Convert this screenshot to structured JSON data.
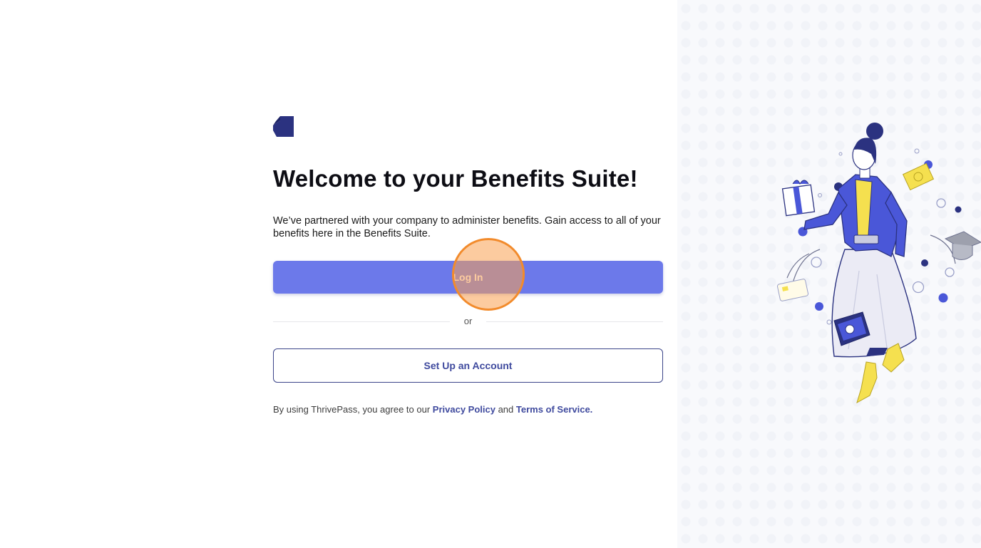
{
  "main": {
    "title": "Welcome to your Benefits Suite!",
    "intro": "We’ve partnered with your company to administer benefits. Gain access to all of your benefits here in the Benefits Suite.",
    "login_label": "Log In",
    "or_label": "or",
    "setup_label": "Set Up an Account",
    "legal_prefix": "By using ThrivePass, you agree to our ",
    "privacy_link": "Privacy Policy",
    "legal_and": " and ",
    "terms_link": "Terms of Service."
  },
  "icons": {
    "logo": "thrivepass-logo-icon",
    "illustration": "benefits-woman-illustration"
  },
  "colors": {
    "brand_dark": "#2b3280",
    "primary_button": "#6c79ea",
    "link": "#3f4a9e",
    "click_marker": "#f28b2c"
  }
}
